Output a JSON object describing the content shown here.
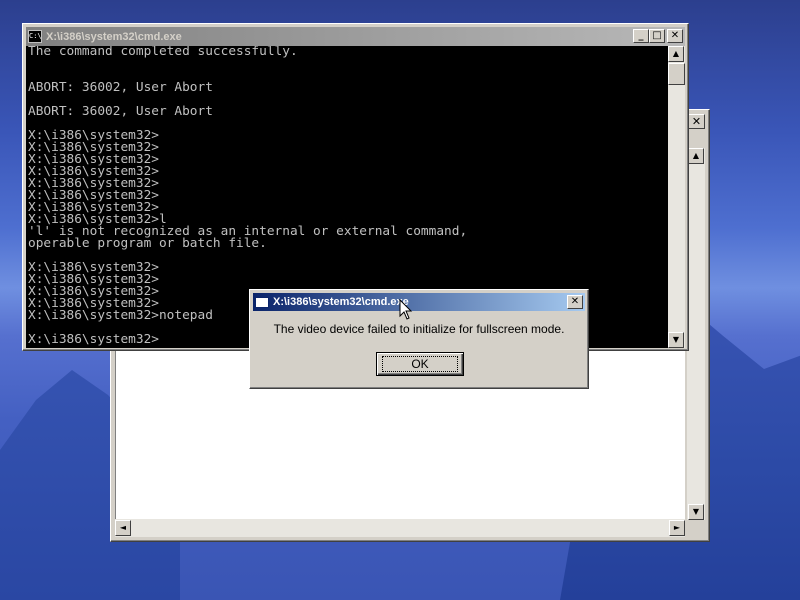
{
  "background_window": {
    "close_glyph": "✕",
    "scroll_up": "▲",
    "scroll_down": "▼",
    "scroll_left": "◄",
    "scroll_right": "►"
  },
  "cmd": {
    "title": "X:\\i386\\system32\\cmd.exe",
    "icon_text": "C:\\",
    "minimize": "_",
    "maximize": "□",
    "close": "✕",
    "lines": [
      "The command completed successfully.",
      "",
      "",
      "ABORT: 36002, User Abort",
      "",
      "ABORT: 36002, User Abort",
      "",
      "X:\\i386\\system32>",
      "X:\\i386\\system32>",
      "X:\\i386\\system32>",
      "X:\\i386\\system32>",
      "X:\\i386\\system32>",
      "X:\\i386\\system32>",
      "X:\\i386\\system32>",
      "X:\\i386\\system32>l",
      "'l' is not recognized as an internal or external command,",
      "operable program or batch file.",
      "",
      "X:\\i386\\system32>",
      "X:\\i386\\system32>",
      "X:\\i386\\system32>",
      "X:\\i386\\system32>",
      "X:\\i386\\system32>notepad",
      "",
      "X:\\i386\\system32>"
    ],
    "scroll_up": "▲",
    "scroll_down": "▼"
  },
  "dialog": {
    "title": "X:\\i386\\system32\\cmd.exe",
    "close": "✕",
    "message": "The video device failed to initialize for fullscreen mode.",
    "ok_label": "OK"
  }
}
